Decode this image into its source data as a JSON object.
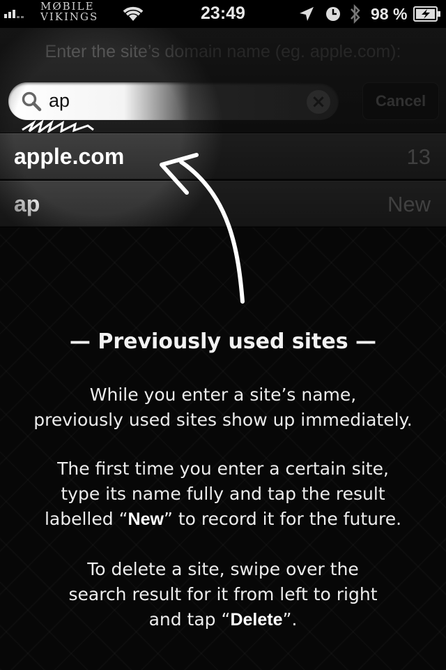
{
  "status_bar": {
    "carrier": "MØBILE VIKINGS",
    "time": "23:49",
    "battery_percent": "98 %",
    "icons": [
      "signal-icon",
      "wifi-icon",
      "location-icon",
      "clock-icon",
      "bluetooth-icon",
      "battery-charging-icon"
    ]
  },
  "search": {
    "prompt": "Enter the site’s domain name (eg. apple.com):",
    "value": "ap",
    "clear_icon": "×",
    "cancel_label": "Cancel"
  },
  "results": [
    {
      "label": "apple.com",
      "count": "13"
    },
    {
      "label": "ap",
      "count": "New"
    }
  ],
  "help": {
    "title": "— Previously used sites —",
    "p1_line1": "While you enter a site’s name,",
    "p1_line2": "previously used sites show up immediately.",
    "p2_line1": "The first time you enter a certain site,",
    "p2_line2": "type its name fully and tap the result",
    "p2_line3a": "labelled “",
    "p2_line3_bold": "New",
    "p2_line3b": "” to record it for the future.",
    "p3_line1": "To delete a site, swipe over the",
    "p3_line2": "search result for it from left to right",
    "p3_line3a": "and tap “",
    "p3_line3_bold": "Delete",
    "p3_line3b": "”."
  },
  "colors": {
    "background": "#060606",
    "row": "#383838",
    "muted_text": "#8f8f8f"
  }
}
